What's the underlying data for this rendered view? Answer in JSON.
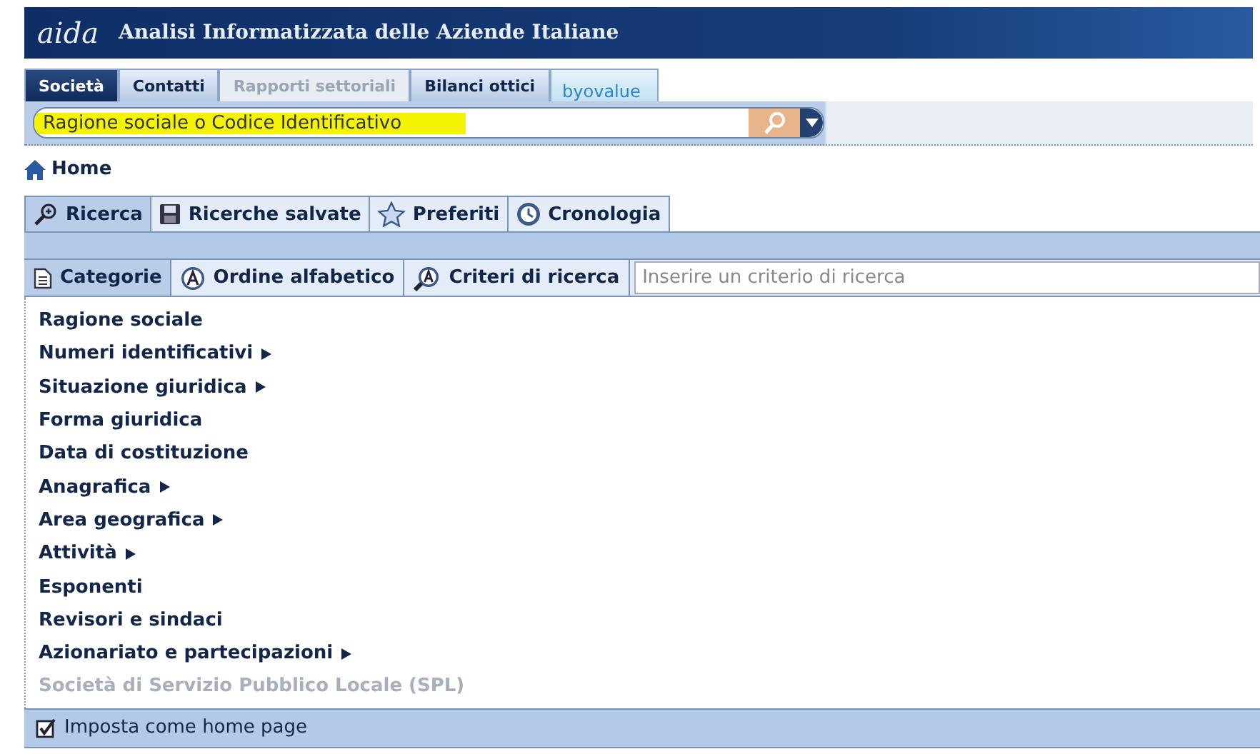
{
  "header": {
    "logo": "aida",
    "title": "Analisi Informatizzata delle Aziende Italiane"
  },
  "tabs": [
    {
      "label": "Società",
      "selected": true,
      "disabled": false,
      "kind": "text"
    },
    {
      "label": "Contatti",
      "selected": false,
      "disabled": false,
      "kind": "text"
    },
    {
      "label": "Rapporti settoriali",
      "selected": false,
      "disabled": true,
      "kind": "text"
    },
    {
      "label": "Bilanci ottici",
      "selected": false,
      "disabled": false,
      "kind": "text"
    },
    {
      "label": "byovalue",
      "selected": false,
      "disabled": false,
      "kind": "logo"
    }
  ],
  "search": {
    "value": "Ragione sociale o Codice Identificativo"
  },
  "breadcrumb": "Home",
  "search_tabs": [
    {
      "label": "Ricerca",
      "selected": true
    },
    {
      "label": "Ricerche salvate",
      "selected": false
    },
    {
      "label": "Preferiti",
      "selected": false
    },
    {
      "label": "Cronologia",
      "selected": false
    }
  ],
  "view_tabs": [
    {
      "label": "Categorie",
      "selected": true
    },
    {
      "label": "Ordine alfabetico",
      "selected": false
    },
    {
      "label": "Criteri di ricerca",
      "selected": false
    }
  ],
  "criteria_search": {
    "placeholder": "Inserire un criterio di ricerca"
  },
  "categories": [
    {
      "label": "Ragione sociale",
      "has_submenu": false,
      "disabled": false
    },
    {
      "label": "Numeri identificativi",
      "has_submenu": true,
      "disabled": false
    },
    {
      "label": "Situazione giuridica",
      "has_submenu": true,
      "disabled": false
    },
    {
      "label": "Forma giuridica",
      "has_submenu": false,
      "disabled": false
    },
    {
      "label": "Data di costituzione",
      "has_submenu": false,
      "disabled": false
    },
    {
      "label": "Anagrafica",
      "has_submenu": true,
      "disabled": false
    },
    {
      "label": "Area geografica",
      "has_submenu": true,
      "disabled": false
    },
    {
      "label": "Attività",
      "has_submenu": true,
      "disabled": false
    },
    {
      "label": "Esponenti",
      "has_submenu": false,
      "disabled": false
    },
    {
      "label": "Revisori e sindaci",
      "has_submenu": false,
      "disabled": false
    },
    {
      "label": "Azionariato e partecipazioni",
      "has_submenu": true,
      "disabled": false
    },
    {
      "label": "Società di Servizio Pubblico Locale (SPL)",
      "has_submenu": false,
      "disabled": true
    }
  ],
  "home_page_option": {
    "label": "Imposta come home page",
    "checked": true
  }
}
